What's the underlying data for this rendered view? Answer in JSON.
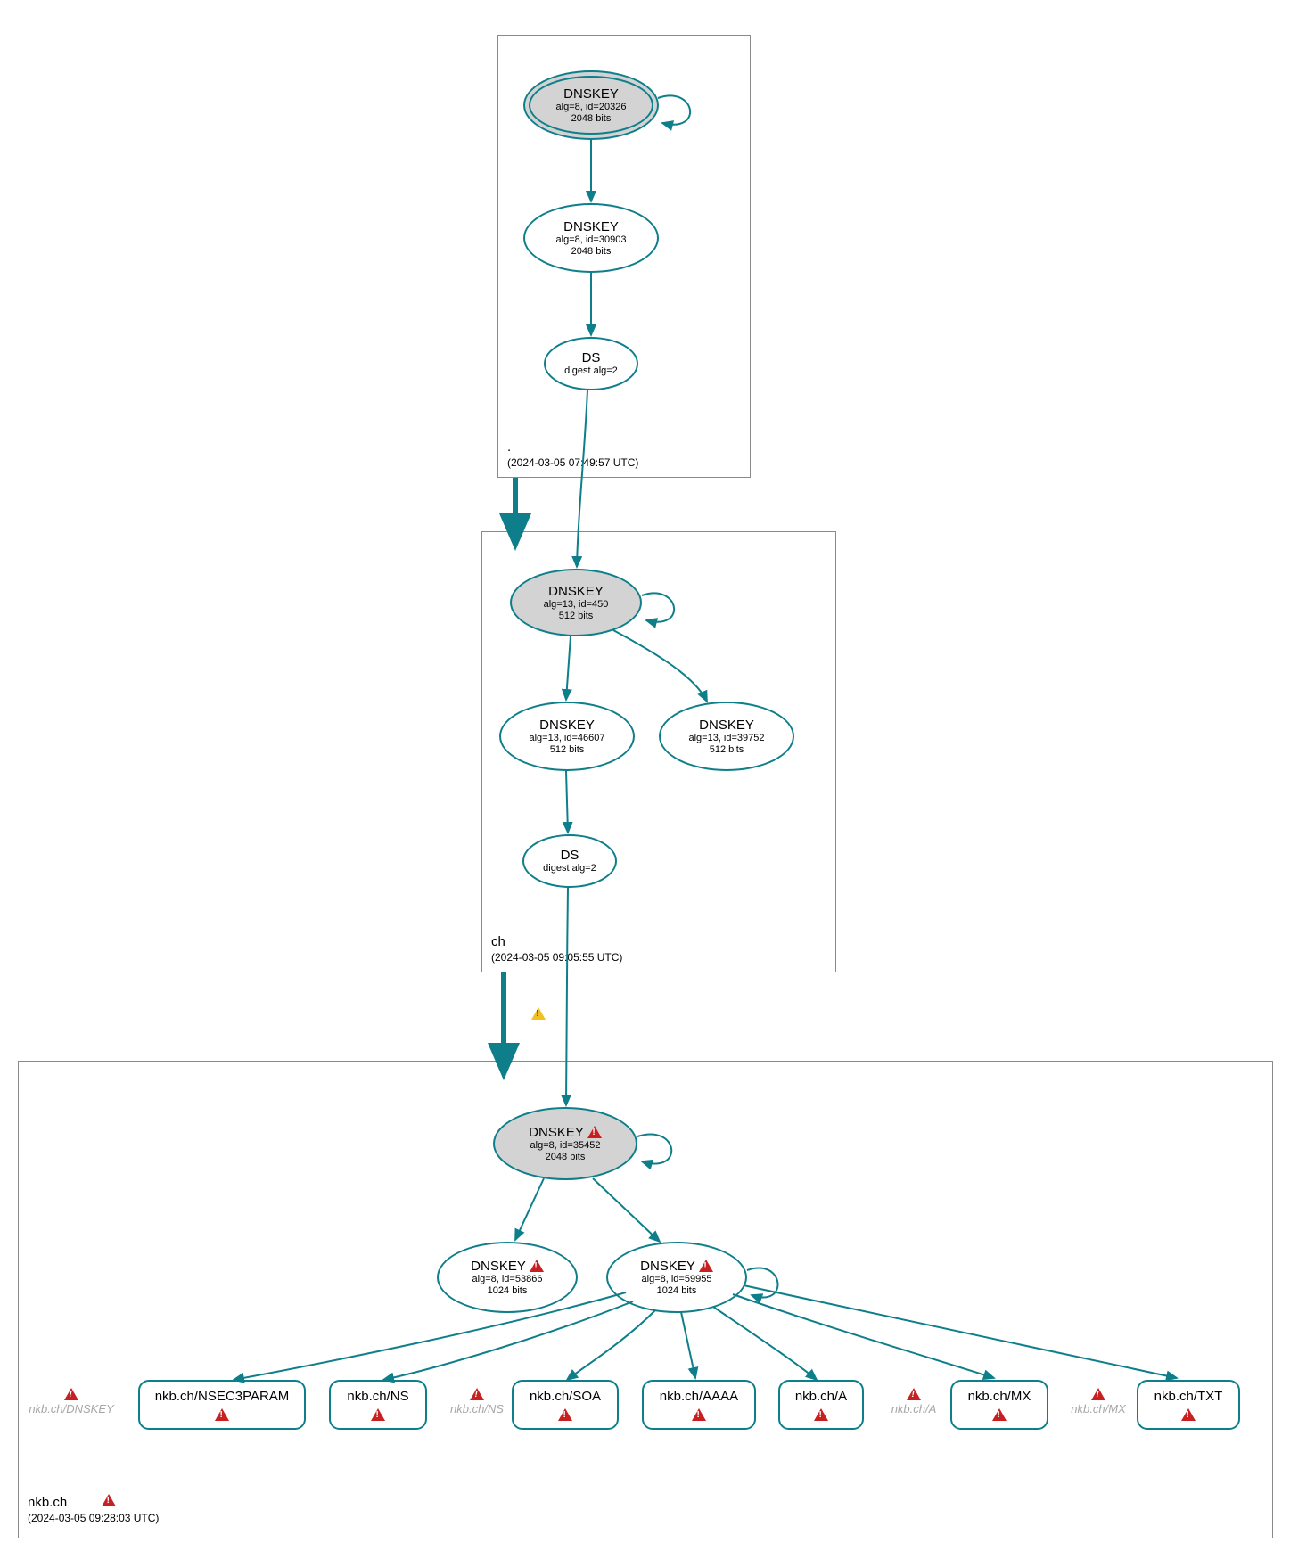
{
  "zones": {
    "root": {
      "name": ".",
      "timestamp": "(2024-03-05 07:49:57 UTC)"
    },
    "ch": {
      "name": "ch",
      "timestamp": "(2024-03-05 09:05:55 UTC)"
    },
    "nkb": {
      "name": "nkb.ch",
      "timestamp": "(2024-03-05 09:28:03 UTC)"
    }
  },
  "nodes": {
    "root_ksk": {
      "title": "DNSKEY",
      "line1": "alg=8, id=20326",
      "line2": "2048 bits"
    },
    "root_zsk": {
      "title": "DNSKEY",
      "line1": "alg=8, id=30903",
      "line2": "2048 bits"
    },
    "root_ds": {
      "title": "DS",
      "line1": "digest alg=2"
    },
    "ch_ksk": {
      "title": "DNSKEY",
      "line1": "alg=13, id=450",
      "line2": "512 bits"
    },
    "ch_zsk": {
      "title": "DNSKEY",
      "line1": "alg=13, id=46607",
      "line2": "512 bits"
    },
    "ch_zsk2": {
      "title": "DNSKEY",
      "line1": "alg=13, id=39752",
      "line2": "512 bits"
    },
    "ch_ds": {
      "title": "DS",
      "line1": "digest alg=2"
    },
    "nkb_ksk": {
      "title": "DNSKEY",
      "line1": "alg=8, id=35452",
      "line2": "2048 bits"
    },
    "nkb_zsk1": {
      "title": "DNSKEY",
      "line1": "alg=8, id=53866",
      "line2": "1024 bits"
    },
    "nkb_zsk2": {
      "title": "DNSKEY",
      "line1": "alg=8, id=59955",
      "line2": "1024 bits"
    }
  },
  "rrsets": {
    "nsec3param": "nkb.ch/NSEC3PARAM",
    "ns": "nkb.ch/NS",
    "soa": "nkb.ch/SOA",
    "aaaa": "nkb.ch/AAAA",
    "a": "nkb.ch/A",
    "mx": "nkb.ch/MX",
    "txt": "nkb.ch/TXT"
  },
  "ghosts": {
    "dnskey": "nkb.ch/DNSKEY",
    "ns": "nkb.ch/NS",
    "a": "nkb.ch/A",
    "mx": "nkb.ch/MX"
  }
}
